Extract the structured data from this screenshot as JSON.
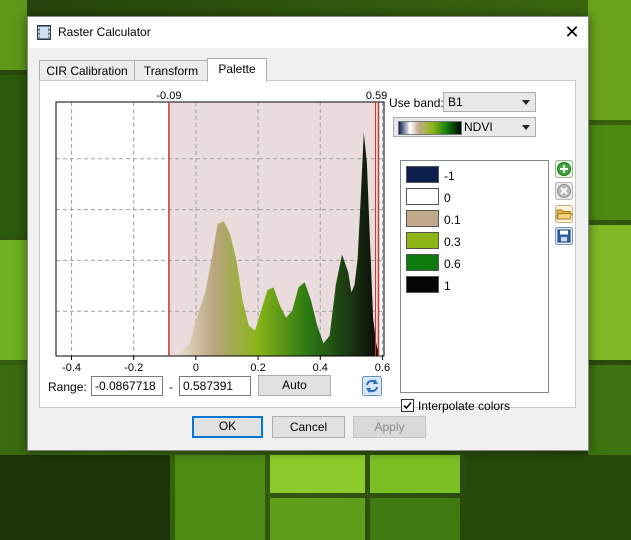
{
  "dialog": {
    "title": "Raster Calculator",
    "close_glyph": "✕"
  },
  "tabs": [
    {
      "label": "CIR Calibration",
      "active": false
    },
    {
      "label": "Transform",
      "active": false
    },
    {
      "label": "Palette",
      "active": true
    }
  ],
  "histogram": {
    "x_ticks": [
      "-0.4",
      "-0.2",
      "0",
      "0.2",
      "0.4",
      "0.6"
    ],
    "xlim": [
      -0.45,
      0.605
    ],
    "range_min_label": "-0.09",
    "range_max_label": "0.59",
    "range_min": -0.0867718,
    "range_max": 0.587391,
    "profile_x": [
      -0.09,
      -0.05,
      -0.02,
      0.0,
      0.03,
      0.05,
      0.07,
      0.09,
      0.11,
      0.13,
      0.15,
      0.17,
      0.19,
      0.21,
      0.23,
      0.25,
      0.27,
      0.29,
      0.31,
      0.33,
      0.35,
      0.37,
      0.39,
      0.41,
      0.43,
      0.45,
      0.47,
      0.49,
      0.5,
      0.51,
      0.52,
      0.53,
      0.54,
      0.55,
      0.56,
      0.57,
      0.58,
      0.59
    ],
    "profile_y": [
      0.0,
      0.01,
      0.05,
      0.14,
      0.25,
      0.38,
      0.52,
      0.53,
      0.48,
      0.38,
      0.22,
      0.12,
      0.1,
      0.18,
      0.26,
      0.27,
      0.2,
      0.15,
      0.18,
      0.27,
      0.29,
      0.22,
      0.12,
      0.05,
      0.08,
      0.28,
      0.4,
      0.33,
      0.25,
      0.28,
      0.38,
      0.62,
      0.88,
      0.76,
      0.45,
      0.15,
      0.05,
      0.0
    ]
  },
  "range": {
    "label": "Range:",
    "min": "-0.0867718",
    "dash": "-",
    "max": "0.587391",
    "auto_label": "Auto"
  },
  "band": {
    "label": "Use band:",
    "value": "B1"
  },
  "palette": {
    "name": "NDVI"
  },
  "colors": [
    {
      "label": "-1",
      "color": "#0c1f4e"
    },
    {
      "label": "0",
      "color": "#ffffff"
    },
    {
      "label": "0.1",
      "color": "#c2a98a"
    },
    {
      "label": "0.3",
      "color": "#8db514"
    },
    {
      "label": "0.6",
      "color": "#0e7a0e"
    },
    {
      "label": "1",
      "color": "#050505"
    }
  ],
  "side_icons": [
    "add-icon",
    "remove-icon",
    "open-folder-icon",
    "save-icon"
  ],
  "interpolate": {
    "label": "Interpolate colors",
    "checked": true
  },
  "buttons": {
    "ok": "OK",
    "cancel": "Cancel",
    "apply": "Apply"
  }
}
